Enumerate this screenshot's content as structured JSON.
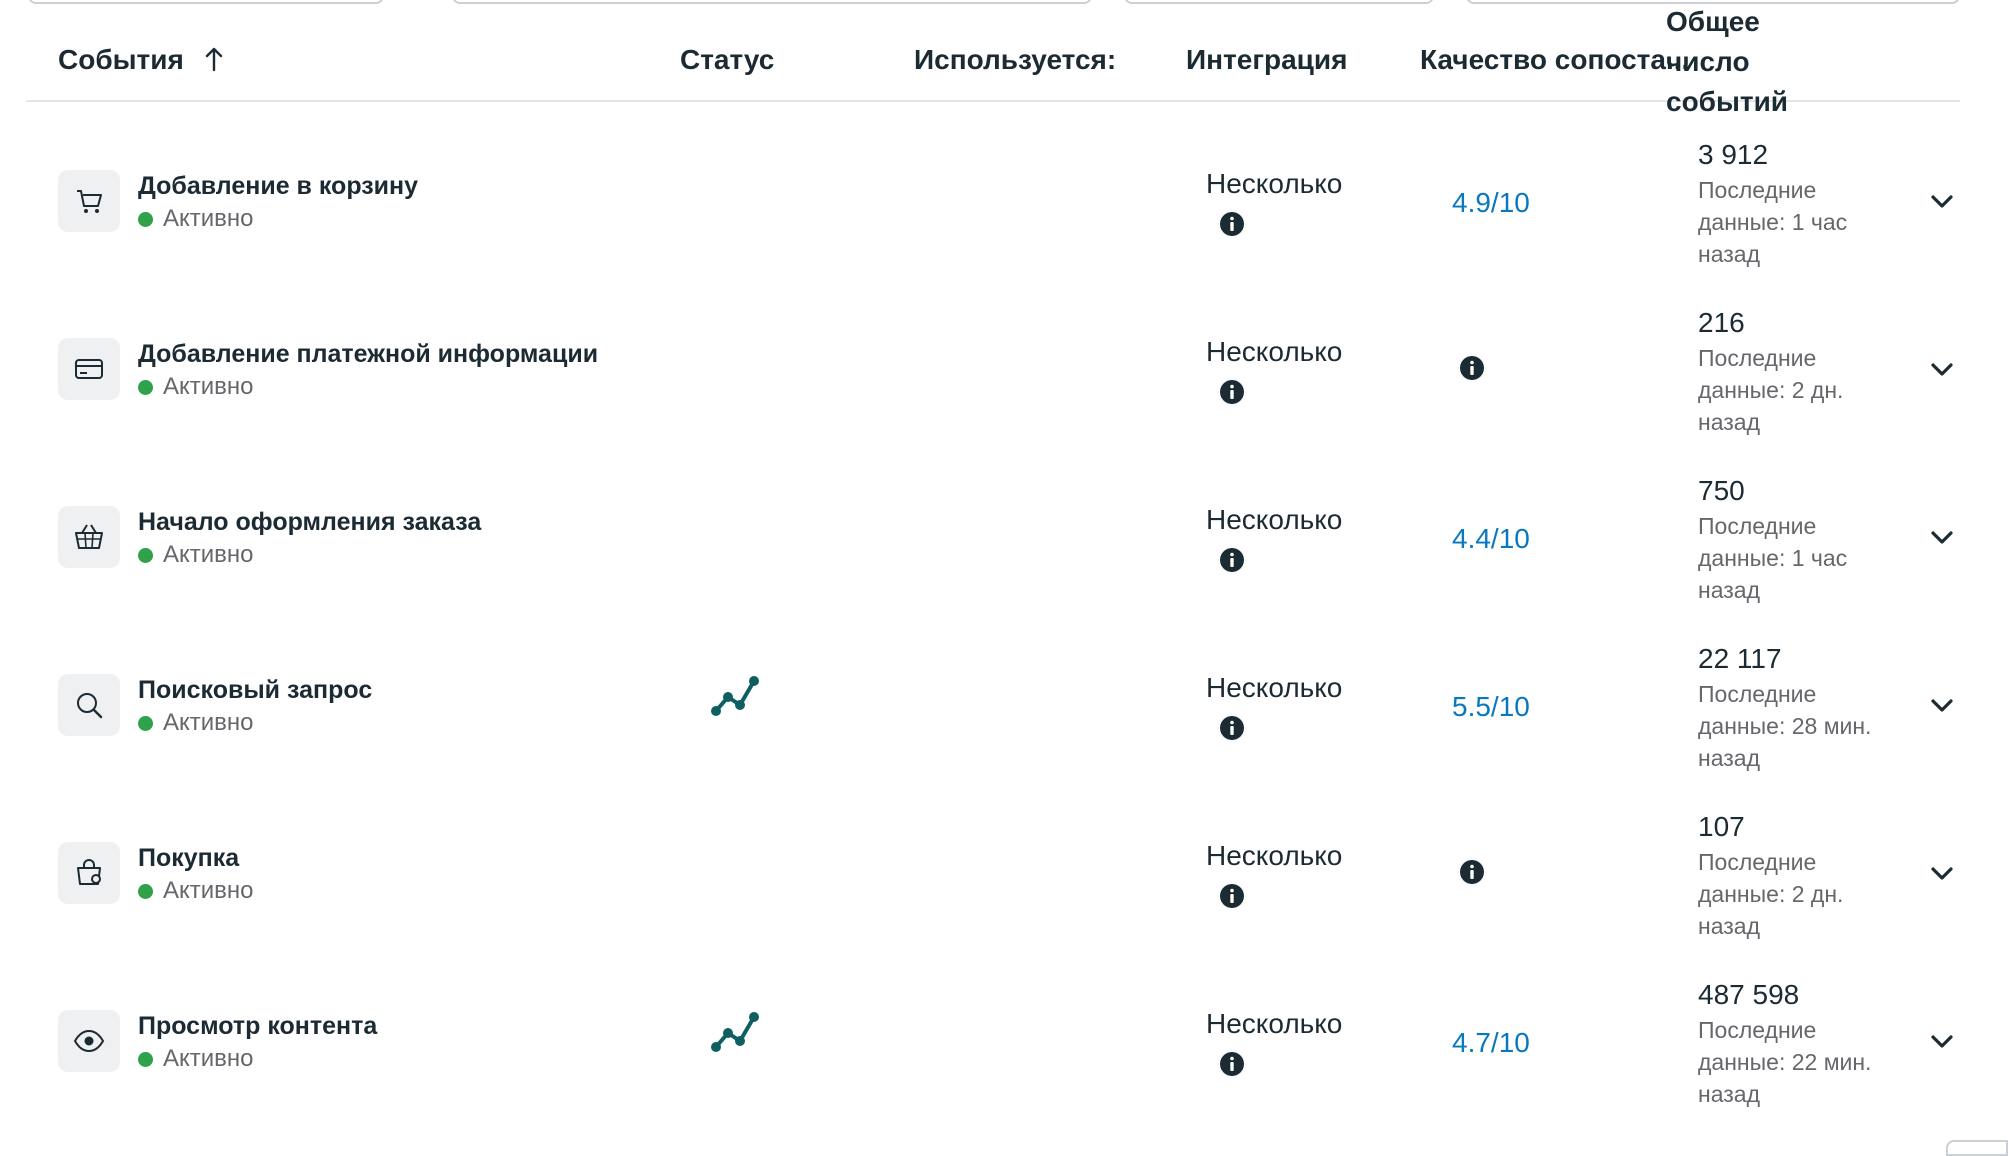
{
  "header": {
    "events": "События",
    "status": "Статус",
    "used_by": "Используется:",
    "integration": "Интеграция",
    "quality": "Качество сопоста...",
    "total": "Общее число событий"
  },
  "rows": [
    {
      "name": "Добавление в корзину",
      "status": "Активно",
      "icon": "cart-icon",
      "trend": false,
      "integration": "Несколько",
      "quality": "4.9/10",
      "count": "3 912",
      "last": "Последние данные: 1 час назад"
    },
    {
      "name": "Добавление платежной информации",
      "status": "Активно",
      "icon": "credit-card-icon",
      "trend": false,
      "integration": "Несколько",
      "quality": "",
      "count": "216",
      "last": "Последние данные: 2 дн. назад"
    },
    {
      "name": "Начало оформления заказа",
      "status": "Активно",
      "icon": "basket-icon",
      "trend": false,
      "integration": "Несколько",
      "quality": "4.4/10",
      "count": "750",
      "last": "Последние данные: 1 час назад"
    },
    {
      "name": "Поисковый запрос",
      "status": "Активно",
      "icon": "search-icon",
      "trend": true,
      "integration": "Несколько",
      "quality": "5.5/10",
      "count": "22 117",
      "last": "Последние данные: 28 мин. назад"
    },
    {
      "name": "Покупка",
      "status": "Активно",
      "icon": "shopping-bag-icon",
      "trend": false,
      "integration": "Несколько",
      "quality": "",
      "count": "107",
      "last": "Последние данные: 2 дн. назад"
    },
    {
      "name": "Просмотр контента",
      "status": "Активно",
      "icon": "eye-icon",
      "trend": true,
      "integration": "Несколько",
      "quality": "4.7/10",
      "count": "487 598",
      "last": "Последние данные: 22 мин. назад"
    }
  ],
  "colors": {
    "active_dot": "#31a24c",
    "quality_link": "#0a78be",
    "trend": "#0f5f62"
  }
}
